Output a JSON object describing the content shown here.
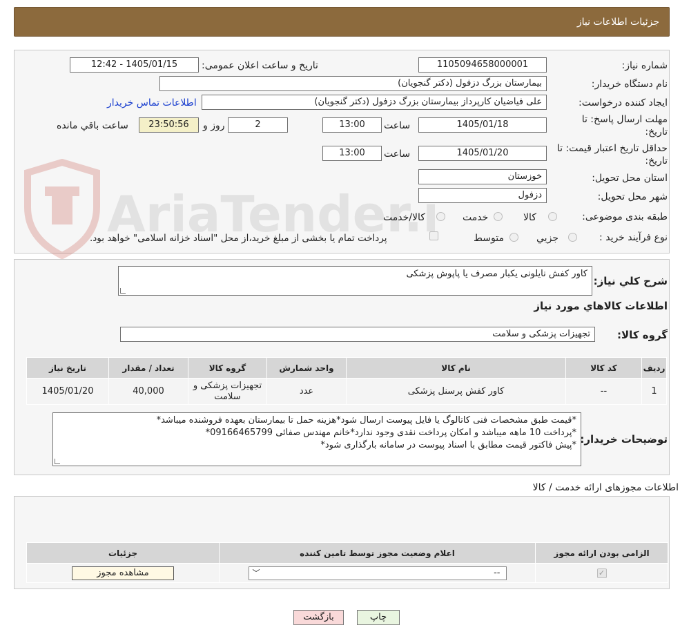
{
  "header": {
    "title": "جزئیات اطلاعات نیاز"
  },
  "form": {
    "need_number_label": "شماره نیاز:",
    "need_number": "1105094658000001",
    "announce_label": "تاریخ و ساعت اعلان عمومی:",
    "announce_value": "1405/01/15 - 12:42",
    "buyer_org_label": "نام دستگاه خریدار:",
    "buyer_org": "بیمارستان بزرگ دزفول (دکتر گنجویان)",
    "creator_label": "ایجاد کننده درخواست:",
    "creator": "علی فیاضیان کارپرداز بیمارستان بزرگ دزفول (دکتر گنجویان)",
    "contact_link": "اطلاعات تماس خریدار",
    "deadline_label_1": "مهلت ارسال پاسخ: تا",
    "deadline_label_2": "تاریخ:",
    "deadline_date": "1405/01/18",
    "time_label": "ساعت",
    "deadline_time": "13:00",
    "days_value": "2",
    "days_label": "روز و",
    "remaining_time": "23:50:56",
    "remaining_label": "ساعت باقي مانده",
    "validity_label_1": "حداقل تاریخ اعتبار قیمت: تا",
    "validity_label_2": "تاریخ:",
    "validity_date": "1405/01/20",
    "validity_time": "13:00",
    "province_label": "استان محل تحویل:",
    "province": "خوزستان",
    "city_label": "شهر محل تحویل:",
    "city": "دزفول",
    "category_label": "طبقه بندی موضوعی:",
    "category_options": [
      "کالا",
      "خدمت",
      "کالا/خدمت"
    ],
    "process_label": "نوع فرآیند خرید :",
    "process_options": [
      "جزیي",
      "متوسط"
    ],
    "payment_note": "پرداخت تمام یا بخشی از مبلغ خرید،از محل \"اسناد خزانه اسلامی\" خواهد بود."
  },
  "summary": {
    "label": "شرح كلي نیاز:",
    "value": "کاور کفش نایلونی یکبار مصرف یا پاپوش پزشکی",
    "goods_title": "اطلاعات كالاهاي مورد نیاز",
    "group_label": "گروه کالا:",
    "group_value": "تجهیزات پزشکی و سلامت"
  },
  "goods_table": {
    "headers": [
      "ردیف",
      "کد کالا",
      "نام کالا",
      "واحد شمارش",
      "گروه کالا",
      "تعداد / مقدار",
      "تاریخ نیاز"
    ],
    "rows": [
      [
        "1",
        "--",
        "کاور کفش پرسنل پزشکی",
        "عدد",
        "تجهیزات پزشکی و سلامت",
        "40,000",
        "1405/01/20"
      ]
    ]
  },
  "buyer_notes": {
    "label": "توضیحات خریدار:",
    "lines": [
      "*قیمت طبق مشخصات فنی کاتالوگ یا فایل پیوست ارسال شود*هزینه حمل تا بیمارستان بعهده فروشنده میباشد*",
      "*پرداخت 10 ماهه میباشد و امکان پرداخت نقدی وجود ندارد*خانم مهندس صفائی 09166465799*",
      "*پیش فاکتور قیمت مطابق با اسناد پیوست در سامانه بارگذاری شود*"
    ]
  },
  "permits": {
    "title": "اطلاعات مجوزهای ارائه خدمت / کالا",
    "headers": [
      "الزامی بودن ارائه مجوز",
      "اعلام وضعیت مجوز توسط تامین کننده",
      "جزئیات"
    ],
    "select_value": "--",
    "view_button": "مشاهده مجوز"
  },
  "buttons": {
    "print": "چاپ",
    "back": "بازگشت"
  },
  "watermark": {
    "text": "AriaTender.neT"
  },
  "colors": {
    "header": "#8c6a3d",
    "back_button": "#f9d9d9",
    "print_button": "#e9f5e0"
  }
}
